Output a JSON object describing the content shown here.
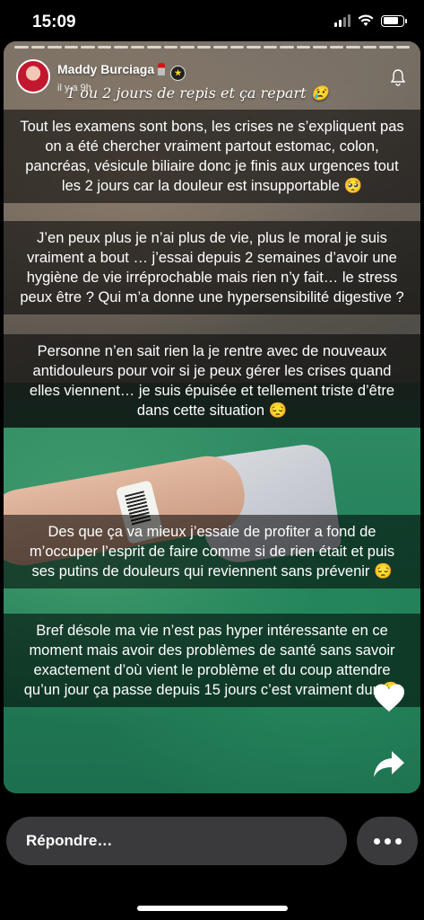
{
  "status_bar": {
    "time": "15:09"
  },
  "story": {
    "author": "Maddy Burciaga",
    "time_ago": "il y a 9h",
    "handwritten_text": "1 ou 2 jours de repis et ça repart 😢",
    "captions": [
      "Tout les examens sont bons, les crises ne s’expliquent pas on a été chercher vraiment partout estomac, colon, pancréas, vésicule biliaire donc je finis aux urgences tout les 2 jours car la douleur est insupportable 🥺",
      "J’en peux plus je n’ai plus de vie, plus le moral je suis vraiment a bout … j’essai depuis 2 semaines d’avoir une hygiène de vie irréprochable mais rien n’y fait… le stress peux être ? Qui m’a donne une hypersensibilité digestive ?",
      "Personne n’en sait rien la je rentre avec de nouveaux antidouleurs pour voir si je peux gérer les crises quand elles viennent… je suis épuisée et tellement triste d’être dans cette situation 😔",
      "Des que ça va mieux j’essaie de profiter a fond de m’occuper l’esprit de faire comme si de rien était et puis ses putins de douleurs qui reviennent sans prévenir 😔",
      "Bref désole ma vie n’est pas hyper intéressante en ce moment mais avoir des problèmes de santé sans savoir exactement d’où vient le problème et du coup attendre qu’un jour ça passe depuis 15 jours c’est vraiment dur 🥺"
    ]
  },
  "reply": {
    "placeholder": "Répondre…"
  },
  "icons": {
    "notification": "bell-icon",
    "like": "heart-icon",
    "share": "share-arrow-icon",
    "more": "more-dots-icon"
  }
}
